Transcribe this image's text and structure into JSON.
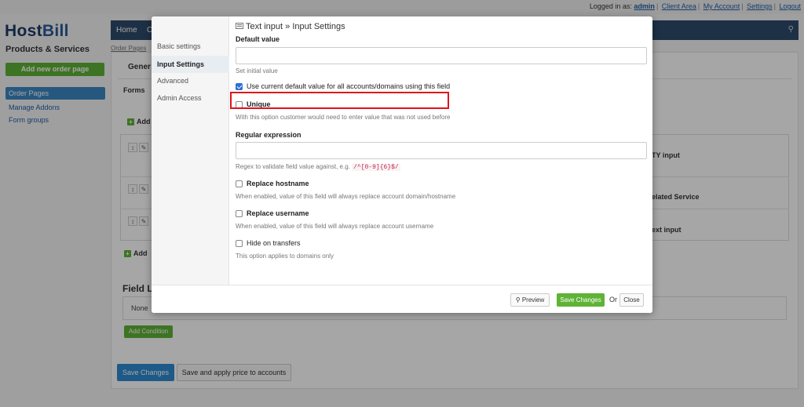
{
  "topbar": {
    "logged_in_label": "Logged in as:",
    "user": "admin",
    "links": [
      "Client Area",
      "My Account",
      "Settings",
      "Logout"
    ]
  },
  "sidebar": {
    "logo_part1": "Host",
    "logo_part2": "Bill",
    "section_title": "Products & Services",
    "add_button": "Add new order page",
    "items": [
      {
        "label": "Order Pages",
        "active": true
      },
      {
        "label": "Manage Addons",
        "active": false
      },
      {
        "label": "Form groups",
        "active": false
      }
    ]
  },
  "main_nav": {
    "items": [
      "Home",
      "C"
    ],
    "search_icon": "search-icon"
  },
  "breadcrumb": "Order Pages",
  "background": {
    "tab_general": "Gener",
    "tab_forms": "Forms",
    "add_field_label": "Add",
    "rows": [
      {
        "name": "TY input"
      },
      {
        "name": "elated Service"
      },
      {
        "name": "ext input"
      }
    ],
    "field_logic_title": "Field L",
    "field_logic_none": "None",
    "add_condition": "Add Condition",
    "save_changes": "Save Changes",
    "save_apply": "Save and apply price to accounts"
  },
  "modal": {
    "title": "Text input » Input Settings",
    "side_items": [
      {
        "label": "Basic settings",
        "active": false
      },
      {
        "label": "Input Settings",
        "active": true
      },
      {
        "label": "Advanced",
        "active": false
      },
      {
        "label": "Admin Access",
        "active": false
      }
    ],
    "default_value": {
      "label": "Default value",
      "value": "",
      "help": "Set initial value"
    },
    "use_current_default": {
      "label": "Use current default value for all accounts/domains using this field",
      "checked": true
    },
    "unique": {
      "label": "Unique",
      "checked": false,
      "help": "With this option customer would need to enter value that was not used before"
    },
    "regex": {
      "label": "Regular expression",
      "value": "",
      "help": "Regex to validate field value against, e.g.",
      "example": "/^[0-9]{6}$/"
    },
    "replace_hostname": {
      "label": "Replace hostname",
      "checked": false,
      "help": "When enabled, value of this field will always replace account domain/hostname"
    },
    "replace_username": {
      "label": "Replace username",
      "checked": false,
      "help": "When enabled, value of this field will always replace account username"
    },
    "hide_on_transfers": {
      "label": "Hide on transfers",
      "checked": false,
      "help": "This option applies to domains only"
    },
    "footer": {
      "preview": "Preview",
      "save": "Save Changes",
      "or": "Or",
      "close": "Close"
    }
  },
  "colors": {
    "accent_green": "#5fb336",
    "nav_dark": "#2e4a6b",
    "highlight_red": "#e1131b",
    "checkbox_blue": "#2d6fd6"
  }
}
